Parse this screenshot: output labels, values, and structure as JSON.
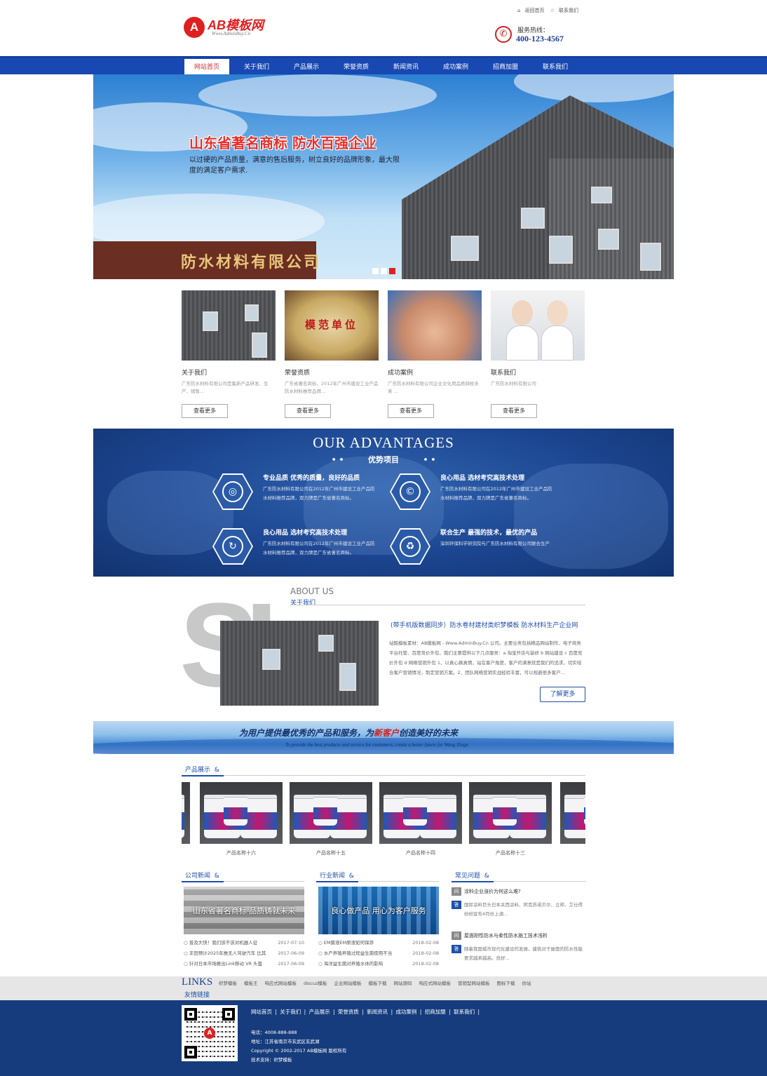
{
  "header": {
    "logo_text": "AB模板网",
    "logo_sub": "Www.AdminBuy.Cn",
    "logo_mark": "A",
    "top_links": [
      "返回首页",
      "联系我们"
    ],
    "hotline_label": "服务热线：",
    "hotline_number": "400-123-4567"
  },
  "nav": {
    "items": [
      "网站首页",
      "关于我们",
      "产品展示",
      "荣誉资质",
      "新闻资讯",
      "成功案例",
      "招商加盟",
      "联系我们"
    ],
    "active_index": 0
  },
  "banner": {
    "headline": "山东省著名商标  防水百强企业",
    "text": "以过硬的产品质量，满意的售后服务，树立良好的品牌形象，最大限度的满足客户需求.",
    "sign": "防水材料有限公司",
    "slides": 3,
    "active_slide": 2
  },
  "cards": [
    {
      "title": "关于我们",
      "desc": "广东防水材料有限公司是集新产品研发、生产、销售...",
      "more": "查看更多"
    },
    {
      "title": "荣誉资质",
      "desc": "广东省著名商标，2012年广州市建设工业产品防水材料推荐品牌...",
      "more": "查看更多",
      "plaque": "模范单位"
    },
    {
      "title": "成功案例",
      "desc": "广东防水材料有限公司企业文化用品质骑枕未来 ...",
      "more": "查看更多"
    },
    {
      "title": "联系我们",
      "desc": "广东防水材料有限公司",
      "more": "查看更多"
    }
  ],
  "advantages": {
    "title": "OUR ADVANTAGES",
    "subtitle": "优势项目",
    "items": [
      {
        "title": "专业品质 优秀的质量，良好的品质",
        "desc": "广东防水材料有限公司在2012年广州市建设工业产品防水材料推荐品牌，双力牌是广东省著名商标。",
        "icon": "quality-icon"
      },
      {
        "title": "良心用品 选材考究高技术处理",
        "desc": "广东防水材料有限公司在2012年广州市建设工业产品防水材料推荐品牌，双力牌是广东省著名商标。",
        "icon": "copyright-icon"
      },
      {
        "title": "良心用品 选材考究高技术处理",
        "desc": "广东防水材料有限公司在2012年广州市建设工业产品防水材料推荐品牌，双力牌是广东省著名商标。",
        "icon": "refresh-icon"
      },
      {
        "title": "联合生产 最强的技术，最优的产品",
        "desc": "深圳环保科学研究院与广东防水材料有限公司联合生产",
        "icon": "recycle-icon"
      }
    ]
  },
  "about": {
    "en": "ABOUT US",
    "cn": "关于我们",
    "title": "(带手机版数据同步）防水卷材建材类织梦模板 防水材料生产企业网",
    "body": "站酷模板素材：AB模板网 - Www.AdminBuy.Cn 公司。主要业务包括精品网站制作、电子商务平台托管、百度竞价外包、我们主要提供以下几点服务：a 淘宝开店与装修 b 网站建设 c 百度竞价外包 d 网络营销外包 1、以真心换真情，站在客户角度，客户的满意就是我们的追求，切实结合客户营销情况，制定营销方案。2、团队网络营销实战经验丰富，可以规避很多客户...",
    "more": "了解更多",
    "bg_letters": "SI"
  },
  "slogan": {
    "cn_before": "为用户提供最优秀的产品和服务，为",
    "cn_highlight": "新客户",
    "cn_after": "创造美好的未来",
    "en": "To provide the best products and service for customers, create a better future for Wang Xingu"
  },
  "products": {
    "title": "产品展示",
    "items": [
      "产品名称十六",
      "产品名称十五",
      "产品名称十四",
      "产品名称十三"
    ]
  },
  "news": {
    "company": {
      "title": "公司新闻",
      "image_caption": "山东省著名商标  品质铸就未来",
      "items": [
        {
          "text": "普及大快！我们该不该对机器人征",
          "date": "2017-07-10"
        },
        {
          "text": "丰田预计2025年推无人驾驶汽车 比其",
          "date": "2017-06-09"
        },
        {
          "text": "针对日本市场推出Link移动 VR 头盔",
          "date": "2017-06-09"
        }
      ]
    },
    "industry": {
      "title": "行业新闻",
      "image_caption": "良心做产品  用心为客户服务",
      "items": [
        {
          "text": "EM菌液EM原液如何保存",
          "date": "2018-02-08"
        },
        {
          "text": "水产养殖养殖过程益生菌使用不当",
          "date": "2018-02-08"
        },
        {
          "text": "海洋益生菌对养殖水体的影响",
          "date": "2018-02-08"
        }
      ]
    },
    "faq": {
      "title": "常见问题",
      "q_badge": "问",
      "a_badge": "答",
      "items": [
        {
          "q": "涂料企业涨价为何这么难?",
          "a": "国际涂料巨头日本关西涂料、阿克苏诺贝尔、立邦、艾仕得纷纷宣布4月份上调..."
        },
        {
          "q": "屋面刚性防水与柔性防水施工技术浅析",
          "a": "随着我国城市现代化建设的发展，建筑对于屋面的防水性能要求越来越高。良好..."
        }
      ]
    }
  },
  "links": {
    "en": "LINKS",
    "cn": "友情链接",
    "items": [
      "织梦模板",
      "模板王",
      "响应式网站模板",
      "discuz模板",
      "企业网站模板",
      "模板下载",
      "网站源码",
      "响应式网站模板",
      "营销型网站模板",
      "图标下载",
      "仿站"
    ]
  },
  "footer": {
    "nav": [
      "网站首页",
      "关于我们",
      "产品展示",
      "荣誉资质",
      "新闻资讯",
      "成功案例",
      "招商加盟",
      "联系我们"
    ],
    "phone": "电话：4008-888-888",
    "address": "地址：江苏省南京市玄武区玄武湖",
    "copyright": "Copyright © 2002-2017 AB模板网 版权所有",
    "tech": "技术支持：织梦模板"
  },
  "colors": {
    "brand_blue": "#1848b2",
    "accent_red": "#e02020",
    "footer_blue": "#163c7d"
  }
}
